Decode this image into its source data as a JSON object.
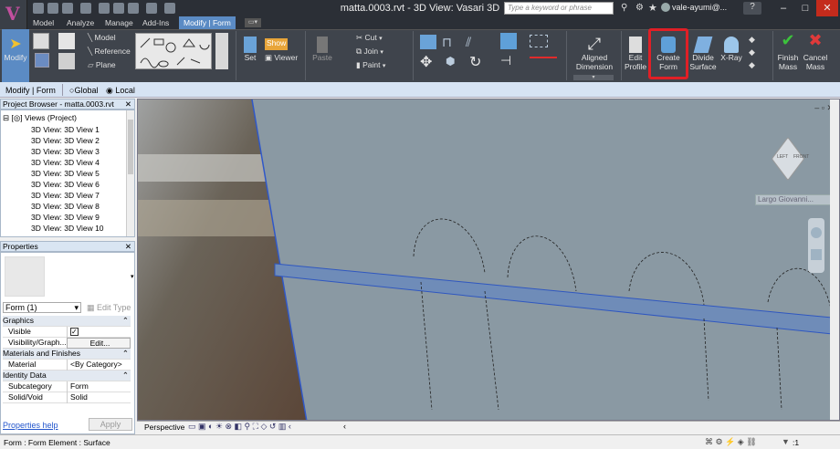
{
  "app": {
    "window_title": "matta.0003.rvt - 3D View: Vasari 3D"
  },
  "search": {
    "placeholder": "Type a keyword or phrase"
  },
  "user": {
    "name": "vale-ayumi@..."
  },
  "tabs": [
    "Model",
    "Analyze",
    "Manage",
    "Add-Ins",
    "Modify | Form"
  ],
  "active_tab": "Modify | Form",
  "ribbon": {
    "modify": "Modify",
    "draw": {
      "model": "Model",
      "reference": "Reference",
      "plane": "Plane"
    },
    "set": "Set",
    "show": "Show",
    "viewer": "Viewer",
    "paste": "Paste",
    "cut": "Cut",
    "join": "Join",
    "paint": "Paint",
    "aligned_dimension": [
      "Aligned",
      "Dimension"
    ],
    "edit_profile": [
      "Edit",
      "Profile"
    ],
    "create_form": [
      "Create",
      "Form"
    ],
    "divide_surface": [
      "Divide",
      "Surface"
    ],
    "xray": "X-Ray",
    "finish_mass": [
      "Finish",
      "Mass"
    ],
    "cancel_mass": [
      "Cancel",
      "Mass"
    ]
  },
  "options_bar": {
    "context": "Modify | Form",
    "global": "Global",
    "local": "Local"
  },
  "project_browser": {
    "title": "Project Browser - matta.0003.rvt",
    "root": "Views (Project)",
    "items": [
      "3D View: 3D View 1",
      "3D View: 3D View 2",
      "3D View: 3D View 3",
      "3D View: 3D View 4",
      "3D View: 3D View 5",
      "3D View: 3D View 6",
      "3D View: 3D View 7",
      "3D View: 3D View 8",
      "3D View: 3D View 9",
      "3D View: 3D View 10"
    ]
  },
  "properties": {
    "title": "Properties",
    "type_selector": "Form (1)",
    "edit_type": "Edit Type",
    "groups": {
      "graphics": "Graphics",
      "materials": "Materials and Finishes",
      "identity": "Identity Data"
    },
    "rows": {
      "visible": "Visible",
      "visibility_graph": "Visibility/Graph...",
      "edit_btn": "Edit...",
      "material": "Material",
      "material_val": "<By Category>",
      "subcategory": "Subcategory",
      "subcategory_val": "Form",
      "solid_void": "Solid/Void",
      "solid_void_val": "Solid"
    },
    "help_link": "Properties help",
    "apply": "Apply"
  },
  "viewport": {
    "location_label": "Largo Giovanni...",
    "viewcube_faces": [
      "LEFT",
      "FRONT"
    ]
  },
  "view_control_bar": {
    "view_type": "Perspective"
  },
  "status_bar": {
    "text": "Form : Form Element : Surface",
    "filter_count": ":1"
  }
}
